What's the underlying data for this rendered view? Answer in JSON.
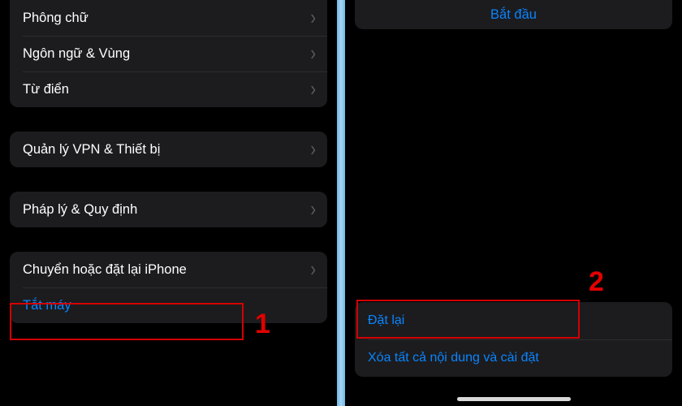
{
  "left": {
    "group1": [
      {
        "label": "Phông chữ"
      },
      {
        "label": "Ngôn ngữ & Vùng"
      },
      {
        "label": "Từ điển"
      }
    ],
    "group2": [
      {
        "label": "Quản lý VPN & Thiết bị"
      }
    ],
    "group3": [
      {
        "label": "Pháp lý & Quy định"
      }
    ],
    "group4": [
      {
        "label": "Chuyển hoặc đặt lại iPhone"
      },
      {
        "label": "Tắt máy",
        "link": true,
        "noChevron": true
      }
    ],
    "callout": "1"
  },
  "right": {
    "start": "Bắt đầu",
    "bottom": [
      {
        "label": "Đặt lại"
      },
      {
        "label": "Xóa tất cả nội dung và cài đặt"
      }
    ],
    "callout": "2"
  }
}
